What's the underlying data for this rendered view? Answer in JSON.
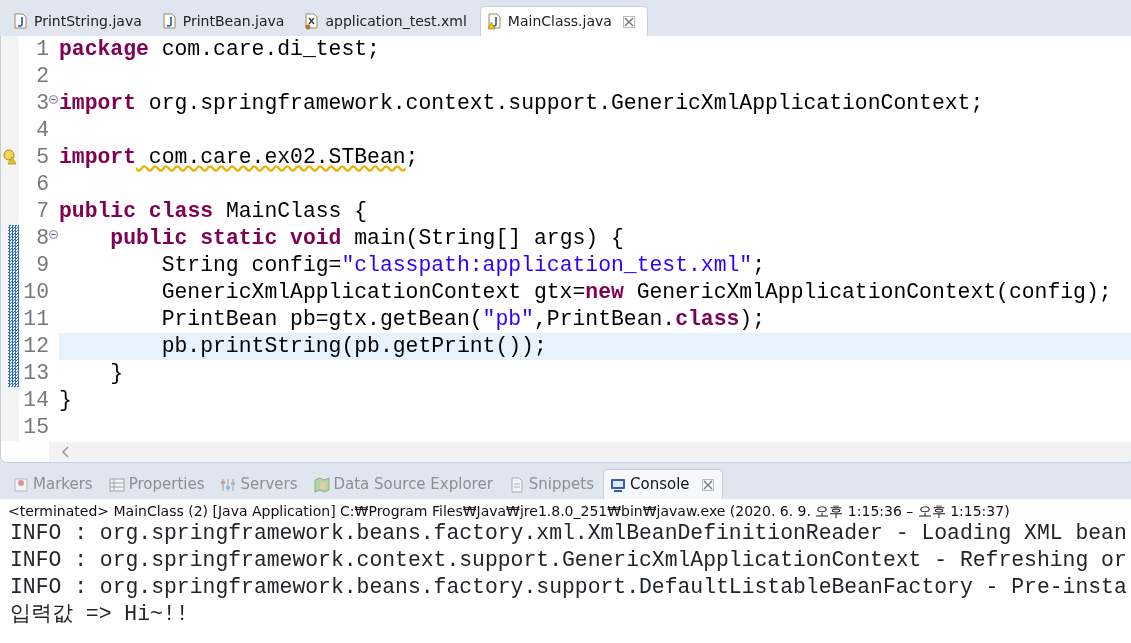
{
  "editor_tabs": [
    {
      "label": "PrintString.java",
      "kind": "java",
      "selected": false,
      "warning": false
    },
    {
      "label": "PrintBean.java",
      "kind": "java",
      "selected": false,
      "warning": false
    },
    {
      "label": "application_test.xml",
      "kind": "xml",
      "selected": false,
      "warning": false
    },
    {
      "label": "MainClass.java",
      "kind": "java",
      "selected": true,
      "warning": true
    }
  ],
  "editor": {
    "lines": [
      {
        "number": "1",
        "selected": false,
        "tokens": [
          {
            "kind": "keyword",
            "text": "package"
          },
          {
            "kind": "plain",
            "text": " com.care.di_test;"
          }
        ]
      },
      {
        "number": "2",
        "selected": false
      },
      {
        "number": "3",
        "selected": false,
        "folded": false,
        "tokens": [
          {
            "kind": "keyword",
            "text": "import"
          },
          {
            "kind": "plain",
            "text": " org.springframework.context.support.GenericXmlApplicationContext;"
          }
        ]
      },
      {
        "number": "4",
        "selected": false
      },
      {
        "number": "5",
        "selected": false,
        "warning": true,
        "tokens": [
          {
            "kind": "keyword",
            "text": "import"
          },
          {
            "kind": "warning",
            "text": " com.care.ex02.STBean"
          },
          {
            "kind": "plain",
            "text": ";"
          }
        ]
      },
      {
        "number": "6",
        "selected": false
      },
      {
        "number": "7",
        "selected": false,
        "tokens": [
          {
            "kind": "keyword",
            "text": "public"
          },
          {
            "kind": "keyword",
            "text": " class"
          },
          {
            "kind": "plain",
            "text": " MainClass {"
          }
        ]
      },
      {
        "number": "8",
        "selected": false,
        "folded": false,
        "changed": true,
        "tokens": [
          {
            "kind": "keyword",
            "text": "    public"
          },
          {
            "kind": "keyword",
            "text": " static"
          },
          {
            "kind": "keyword",
            "text": " void"
          },
          {
            "kind": "plain",
            "text": " main(String[] args) {"
          }
        ]
      },
      {
        "number": "9",
        "selected": false,
        "changed": true,
        "tokens": [
          {
            "kind": "plain",
            "text": "        String config="
          },
          {
            "kind": "string",
            "text": "\"classpath:application_test.xml\""
          },
          {
            "kind": "plain",
            "text": ";"
          }
        ]
      },
      {
        "number": "10",
        "selected": false,
        "changed": true,
        "tokens": [
          {
            "kind": "plain",
            "text": "        GenericXmlApplicationContext gtx="
          },
          {
            "kind": "keyword",
            "text": "new"
          },
          {
            "kind": "plain",
            "text": " GenericXmlApplicationContext(config);"
          }
        ]
      },
      {
        "number": "11",
        "selected": false,
        "changed": true,
        "tokens": [
          {
            "kind": "plain",
            "text": "        PrintBean pb=gtx.getBean("
          },
          {
            "kind": "string",
            "text": "\"pb\""
          },
          {
            "kind": "plain",
            "text": ",PrintBean."
          },
          {
            "kind": "keyword",
            "text": "class"
          },
          {
            "kind": "plain",
            "text": ");"
          }
        ]
      },
      {
        "number": "12",
        "selected": true,
        "changed": true,
        "tokens": [
          {
            "kind": "plain",
            "text": "        pb.printString(pb.getPrint());"
          }
        ]
      },
      {
        "number": "13",
        "selected": false,
        "changed": true,
        "tokens": [
          {
            "kind": "plain",
            "text": "    }"
          }
        ]
      },
      {
        "number": "14",
        "selected": false,
        "tokens": [
          {
            "kind": "plain",
            "text": "}"
          }
        ]
      },
      {
        "number": "15",
        "selected": false
      }
    ]
  },
  "panel_tabs": [
    {
      "label": "Markers",
      "kind": "markers",
      "selected": false
    },
    {
      "label": "Properties",
      "kind": "properties",
      "selected": false
    },
    {
      "label": "Servers",
      "kind": "servers",
      "selected": false
    },
    {
      "label": "Data Source Explorer",
      "kind": "datasource",
      "selected": false
    },
    {
      "label": "Snippets",
      "kind": "snippets",
      "selected": false
    },
    {
      "label": "Console",
      "kind": "console",
      "selected": true
    }
  ],
  "console": {
    "header": "<terminated> MainClass (2) [Java Application] C:₩Program Files₩Java₩jre1.8.0_251₩bin₩javaw.exe  (2020. 6. 9. 오후 1:15:36 – 오후 1:15:37)",
    "lines": [
      "INFO : org.springframework.beans.factory.xml.XmlBeanDefinitionReader - Loading XML bean",
      "INFO : org.springframework.context.support.GenericXmlApplicationContext - Refreshing or",
      "INFO : org.springframework.beans.factory.support.DefaultListableBeanFactory - Pre-insta",
      "입력값 => Hi~!!"
    ]
  }
}
